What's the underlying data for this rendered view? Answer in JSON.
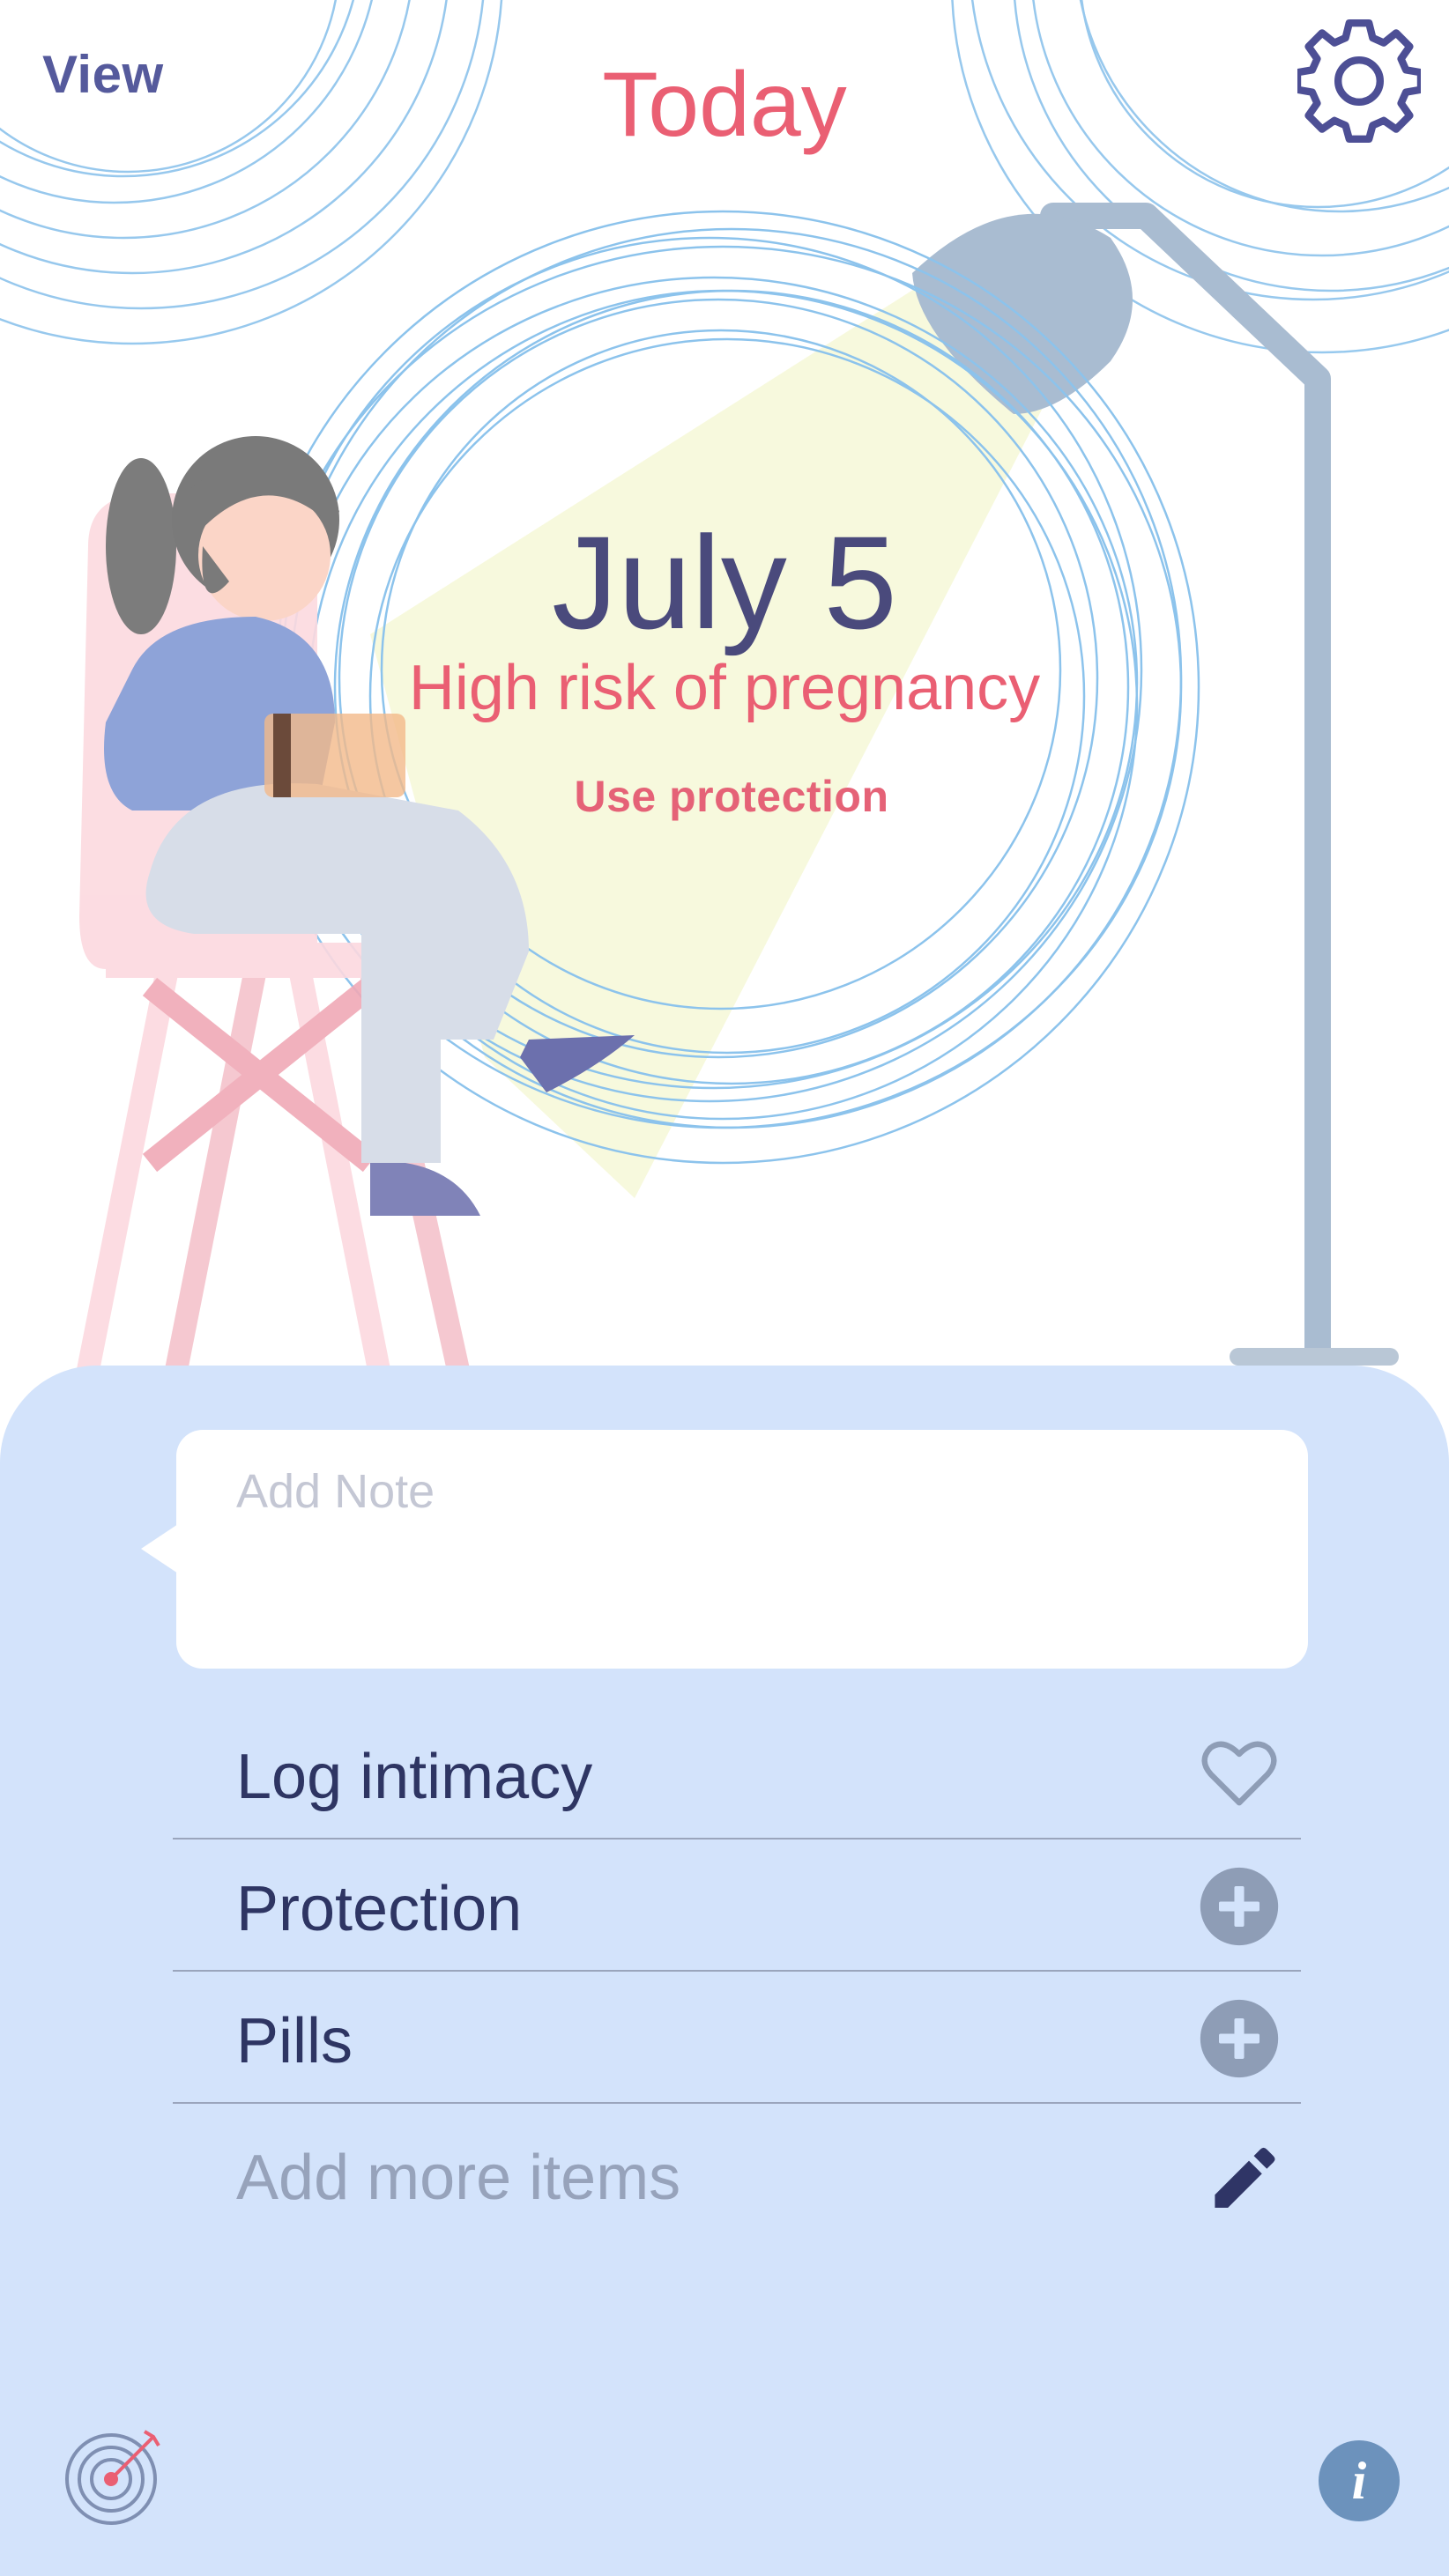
{
  "header": {
    "view_label": "View",
    "title": "Today"
  },
  "hero": {
    "date": "July 5",
    "risk": "High risk of pregnancy",
    "advice": "Use protection"
  },
  "note": {
    "placeholder": "Add Note",
    "value": ""
  },
  "items": [
    {
      "label": "Log intimacy",
      "icon": "heart-icon"
    },
    {
      "label": "Protection",
      "icon": "plus-circle-icon"
    },
    {
      "label": "Pills",
      "icon": "plus-circle-icon"
    },
    {
      "label": "Add more items",
      "icon": "pencil-icon"
    }
  ],
  "footer": {
    "left_icon": "target-icon",
    "info_label": "i"
  },
  "colors": {
    "accent_pink": "#ea5f73",
    "navy": "#4a4a7c",
    "panel_blue": "#d3e3fb",
    "icon_gray": "#8e9db6"
  }
}
